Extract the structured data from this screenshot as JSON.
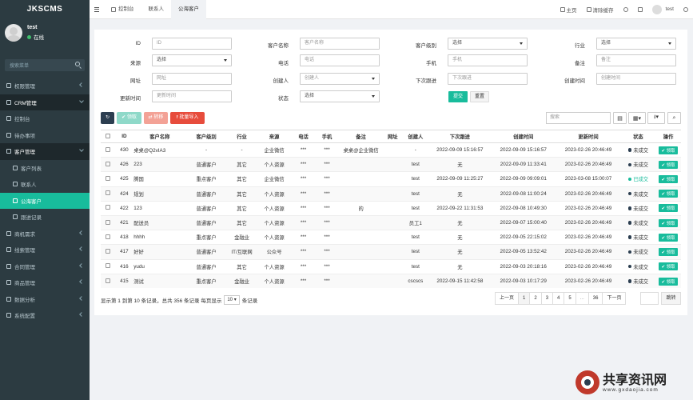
{
  "app": {
    "logo": "JKSCMS"
  },
  "user": {
    "name": "test",
    "status": "在线"
  },
  "sidebar": {
    "search_placeholder": "搜索菜单",
    "items": [
      {
        "label": "权限管理",
        "icon": "group-icon",
        "state": "collapsed"
      },
      {
        "label": "CRM管理",
        "icon": "list-icon",
        "state": "open"
      },
      {
        "label": "控制台",
        "icon": "dashboard-icon",
        "state": "sub"
      },
      {
        "label": "待办事项",
        "icon": "todo-icon",
        "state": "sub"
      },
      {
        "label": "客户管理",
        "icon": "users-icon",
        "state": "open-sub"
      },
      {
        "label": "客户列表",
        "icon": "list-icon",
        "state": "subsub"
      },
      {
        "label": "联系人",
        "icon": "contact-icon",
        "state": "subsub"
      },
      {
        "label": "公海客户",
        "icon": "cloud-icon",
        "state": "active"
      },
      {
        "label": "跟进记录",
        "icon": "record-icon",
        "state": "subsub"
      },
      {
        "label": "商机需求",
        "icon": "deal-icon",
        "state": "collapsed"
      },
      {
        "label": "线索管理",
        "icon": "lead-icon",
        "state": "collapsed"
      },
      {
        "label": "合同管理",
        "icon": "contract-icon",
        "state": "collapsed"
      },
      {
        "label": "商品管理",
        "icon": "goods-icon",
        "state": "collapsed"
      },
      {
        "label": "数据分析",
        "icon": "chart-icon",
        "state": "collapsed"
      },
      {
        "label": "系统配置",
        "icon": "gear-icon",
        "state": "collapsed"
      }
    ]
  },
  "topbar": {
    "tabs": [
      {
        "label": "控制台",
        "icon": "dashboard-icon"
      },
      {
        "label": "联系人",
        "icon": ""
      },
      {
        "label": "公海客户",
        "icon": ""
      }
    ],
    "home": "主页",
    "clear_cache": "清除缓存",
    "username": "test"
  },
  "filters": {
    "id_label": "ID",
    "id_placeholder": "ID",
    "name_label": "客户名称",
    "name_placeholder": "客户名称",
    "level_label": "客户级别",
    "level_value": "选择",
    "industry_label": "行业",
    "industry_value": "选择",
    "source_label": "来源",
    "source_value": "选择",
    "phone_label": "电话",
    "phone_placeholder": "电话",
    "mobile_label": "手机",
    "mobile_placeholder": "手机",
    "remark_label": "备注",
    "remark_placeholder": "备注",
    "website_label": "网址",
    "website_placeholder": "网址",
    "creator_label": "创建人",
    "creator_value": "创建人",
    "next_label": "下次跟进",
    "next_placeholder": "下次跟进",
    "created_label": "创建时间",
    "created_placeholder": "创建时间",
    "updated_label": "更新时间",
    "updated_placeholder": "更新时间",
    "status_label": "状态",
    "status_value": "选择",
    "submit": "提交",
    "reset": "重置"
  },
  "toolbar": {
    "claim": "领取",
    "transfer": "转移",
    "import": "批量导入",
    "search_placeholder": "搜索"
  },
  "table": {
    "headers": [
      "ID",
      "客户名称",
      "客户级别",
      "行业",
      "来源",
      "电话",
      "手机",
      "备注",
      "网址",
      "创建人",
      "下次跟进",
      "创建时间",
      "更新时间",
      "状态",
      "操作"
    ],
    "rows": [
      {
        "id": "430",
        "name": "桌桌@Q2vIA3",
        "level": "-",
        "industry": "-",
        "source": "企业微信",
        "phone": "***",
        "mobile": "***",
        "remark": "桌桌@企业微信",
        "website": "",
        "creator": "-",
        "next": "2022-09-09 15:16:57",
        "created": "2022-09-09 15:16:57",
        "updated": "2023-02-26 20:46:49",
        "status": "未成交",
        "status_color": "#2c3e50",
        "op": "领取"
      },
      {
        "id": "426",
        "name": "223",
        "level": "普通客户",
        "industry": "其它",
        "source": "个人资源",
        "phone": "***",
        "mobile": "***",
        "remark": "",
        "website": "",
        "creator": "test",
        "next": "无",
        "created": "2022-09-09 11:33:41",
        "updated": "2023-02-26 20:46:49",
        "status": "未成交",
        "status_color": "#2c3e50",
        "op": "领取"
      },
      {
        "id": "425",
        "name": "腾国",
        "level": "重点客户",
        "industry": "其它",
        "source": "企业微信",
        "phone": "***",
        "mobile": "***",
        "remark": "",
        "website": "",
        "creator": "test",
        "next": "2022-09-09 11:25:27",
        "created": "2022-09-09 09:09:01",
        "updated": "2023-03-08 15:00:07",
        "status": "已成交",
        "status_color": "#18bc9c",
        "op": "领取"
      },
      {
        "id": "424",
        "name": "规划",
        "level": "普通客户",
        "industry": "其它",
        "source": "个人资源",
        "phone": "***",
        "mobile": "***",
        "remark": "",
        "website": "",
        "creator": "test",
        "next": "无",
        "created": "2022-09-08 11:00:24",
        "updated": "2023-02-26 20:46:49",
        "status": "未成交",
        "status_color": "#2c3e50",
        "op": "领取"
      },
      {
        "id": "422",
        "name": "123",
        "level": "普通客户",
        "industry": "其它",
        "source": "个人资源",
        "phone": "***",
        "mobile": "***",
        "remark": "的",
        "website": "",
        "creator": "test",
        "next": "2022-09-22 11:31:53",
        "created": "2022-09-08 10:49:30",
        "updated": "2023-02-26 20:46:49",
        "status": "未成交",
        "status_color": "#2c3e50",
        "op": "领取"
      },
      {
        "id": "421",
        "name": "配送员",
        "level": "普通客户",
        "industry": "其它",
        "source": "个人资源",
        "phone": "***",
        "mobile": "***",
        "remark": "",
        "website": "",
        "creator": "员工1",
        "next": "无",
        "created": "2022-09-07 15:00:40",
        "updated": "2023-02-26 20:46:49",
        "status": "未成交",
        "status_color": "#2c3e50",
        "op": "领取"
      },
      {
        "id": "418",
        "name": "hhhh",
        "level": "重点客户",
        "industry": "金融业",
        "source": "个人资源",
        "phone": "***",
        "mobile": "***",
        "remark": "",
        "website": "",
        "creator": "test",
        "next": "无",
        "created": "2022-09-05 22:15:02",
        "updated": "2023-02-26 20:46:49",
        "status": "未成交",
        "status_color": "#2c3e50",
        "op": "领取"
      },
      {
        "id": "417",
        "name": "好好",
        "level": "普通客户",
        "industry": "IT/互联网",
        "source": "公众号",
        "phone": "***",
        "mobile": "***",
        "remark": "",
        "website": "",
        "creator": "test",
        "next": "无",
        "created": "2022-09-05 13:52:42",
        "updated": "2023-02-26 20:46:49",
        "status": "未成交",
        "status_color": "#2c3e50",
        "op": "领取"
      },
      {
        "id": "416",
        "name": "yudu",
        "level": "普通客户",
        "industry": "其它",
        "source": "个人资源",
        "phone": "***",
        "mobile": "***",
        "remark": "",
        "website": "",
        "creator": "test",
        "next": "无",
        "created": "2022-09-03 20:18:16",
        "updated": "2023-02-26 20:46:49",
        "status": "未成交",
        "status_color": "#2c3e50",
        "op": "领取"
      },
      {
        "id": "415",
        "name": "测试",
        "level": "重点客户",
        "industry": "金融业",
        "source": "个人资源",
        "phone": "***",
        "mobile": "***",
        "remark": "",
        "website": "",
        "creator": "cscscs",
        "next": "2022-09-15 11:42:58",
        "created": "2022-09-03 10:17:29",
        "updated": "2023-02-26 20:46:49",
        "status": "未成交",
        "status_color": "#2c3e50",
        "op": "领取"
      }
    ]
  },
  "pagination": {
    "info": "显示第 1 到第 10 条记录，总共 356 条记录 每页显示",
    "per_page": "10",
    "suffix": "条记录",
    "prev": "上一页",
    "pages": [
      "1",
      "2",
      "3",
      "4",
      "5",
      "...",
      "36"
    ],
    "next": "下一页",
    "jump": "跳转"
  },
  "watermark": {
    "title": "共享资讯网",
    "url": "www.gxdaojia.com"
  }
}
